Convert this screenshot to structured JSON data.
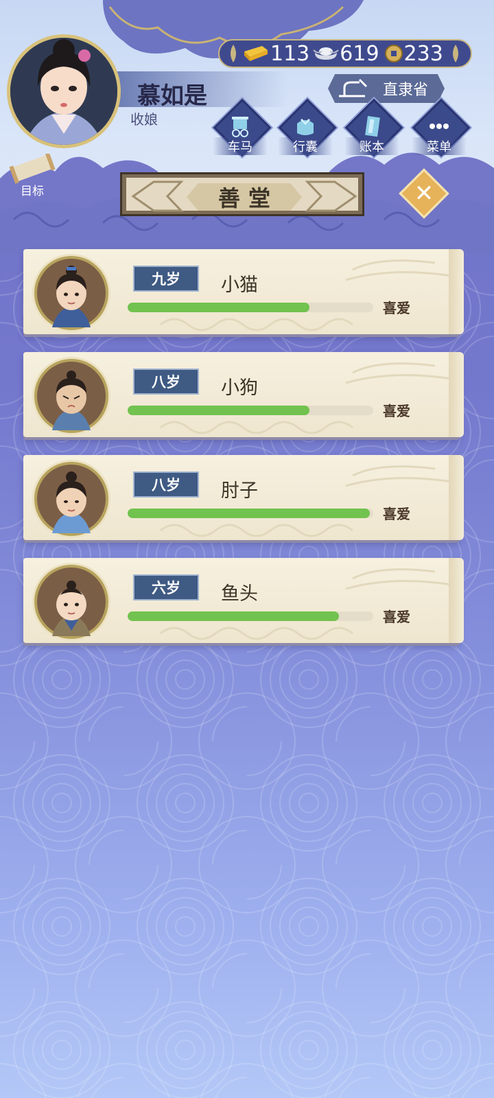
{
  "player": {
    "name": "慕如是",
    "title": "收娘"
  },
  "currency": {
    "gold": "113",
    "silver": "619",
    "coin": "233"
  },
  "location": "直隶省",
  "menu": [
    {
      "label": "车马",
      "icon": "carriage-icon"
    },
    {
      "label": "行囊",
      "icon": "bundle-icon"
    },
    {
      "label": "账本",
      "icon": "ledger-icon"
    },
    {
      "label": "菜单",
      "icon": "more-icon"
    }
  ],
  "goal_label": "目标",
  "panel_title": "善堂",
  "children": [
    {
      "age": "九岁",
      "name": "小猫",
      "affinity_label": "喜爱",
      "affinity": 0.74
    },
    {
      "age": "八岁",
      "name": "小狗",
      "affinity_label": "喜爱",
      "affinity": 0.74
    },
    {
      "age": "八岁",
      "name": "肘子",
      "affinity_label": "喜爱",
      "affinity": 0.985
    },
    {
      "age": "六岁",
      "name": "鱼头",
      "affinity_label": "喜爱",
      "affinity": 0.86
    }
  ],
  "colors": {
    "bar_fill": "#72c24f",
    "badge": "#3f5a83",
    "plaque": "#e4d9c2"
  }
}
